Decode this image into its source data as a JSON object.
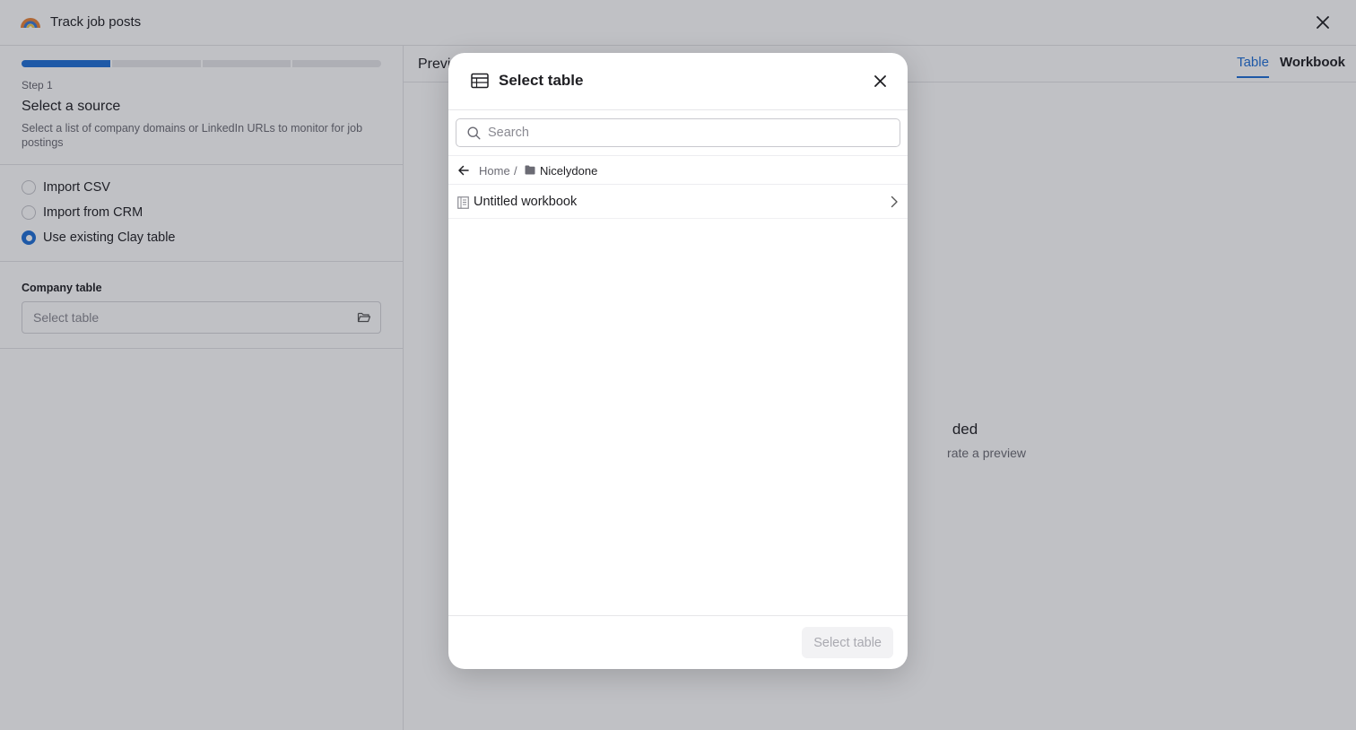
{
  "app": {
    "title": "Track job posts"
  },
  "steps": {
    "progress_segments": 4,
    "active_segments": 1
  },
  "source_step": {
    "step_label": "Step 1",
    "title": "Select a source",
    "description": "Select a list of company domains or LinkedIn URLs to monitor for job postings",
    "options": [
      {
        "label": "Import CSV",
        "checked": false
      },
      {
        "label": "Import from CRM",
        "checked": false
      },
      {
        "label": "Use existing Clay table",
        "checked": true
      }
    ],
    "company_table_label": "Company table",
    "company_table_placeholder": "Select table"
  },
  "preview": {
    "title": "Previ",
    "tabs": [
      {
        "label": "Table",
        "active": true
      },
      {
        "label": "Workbook",
        "active": false
      }
    ],
    "empty_title": "ded",
    "empty_desc": "rate a preview"
  },
  "modal": {
    "title": "Select table",
    "search_placeholder": "Search",
    "breadcrumb": {
      "home": "Home",
      "separator": "/",
      "folder": "Nicelydone"
    },
    "items": [
      {
        "label": "Untitled workbook",
        "icon": "workbook-icon"
      }
    ],
    "footer_button": "Select table"
  },
  "colors": {
    "accent": "#1f6fd6",
    "overlay": "rgba(30,33,48,0.28)"
  }
}
